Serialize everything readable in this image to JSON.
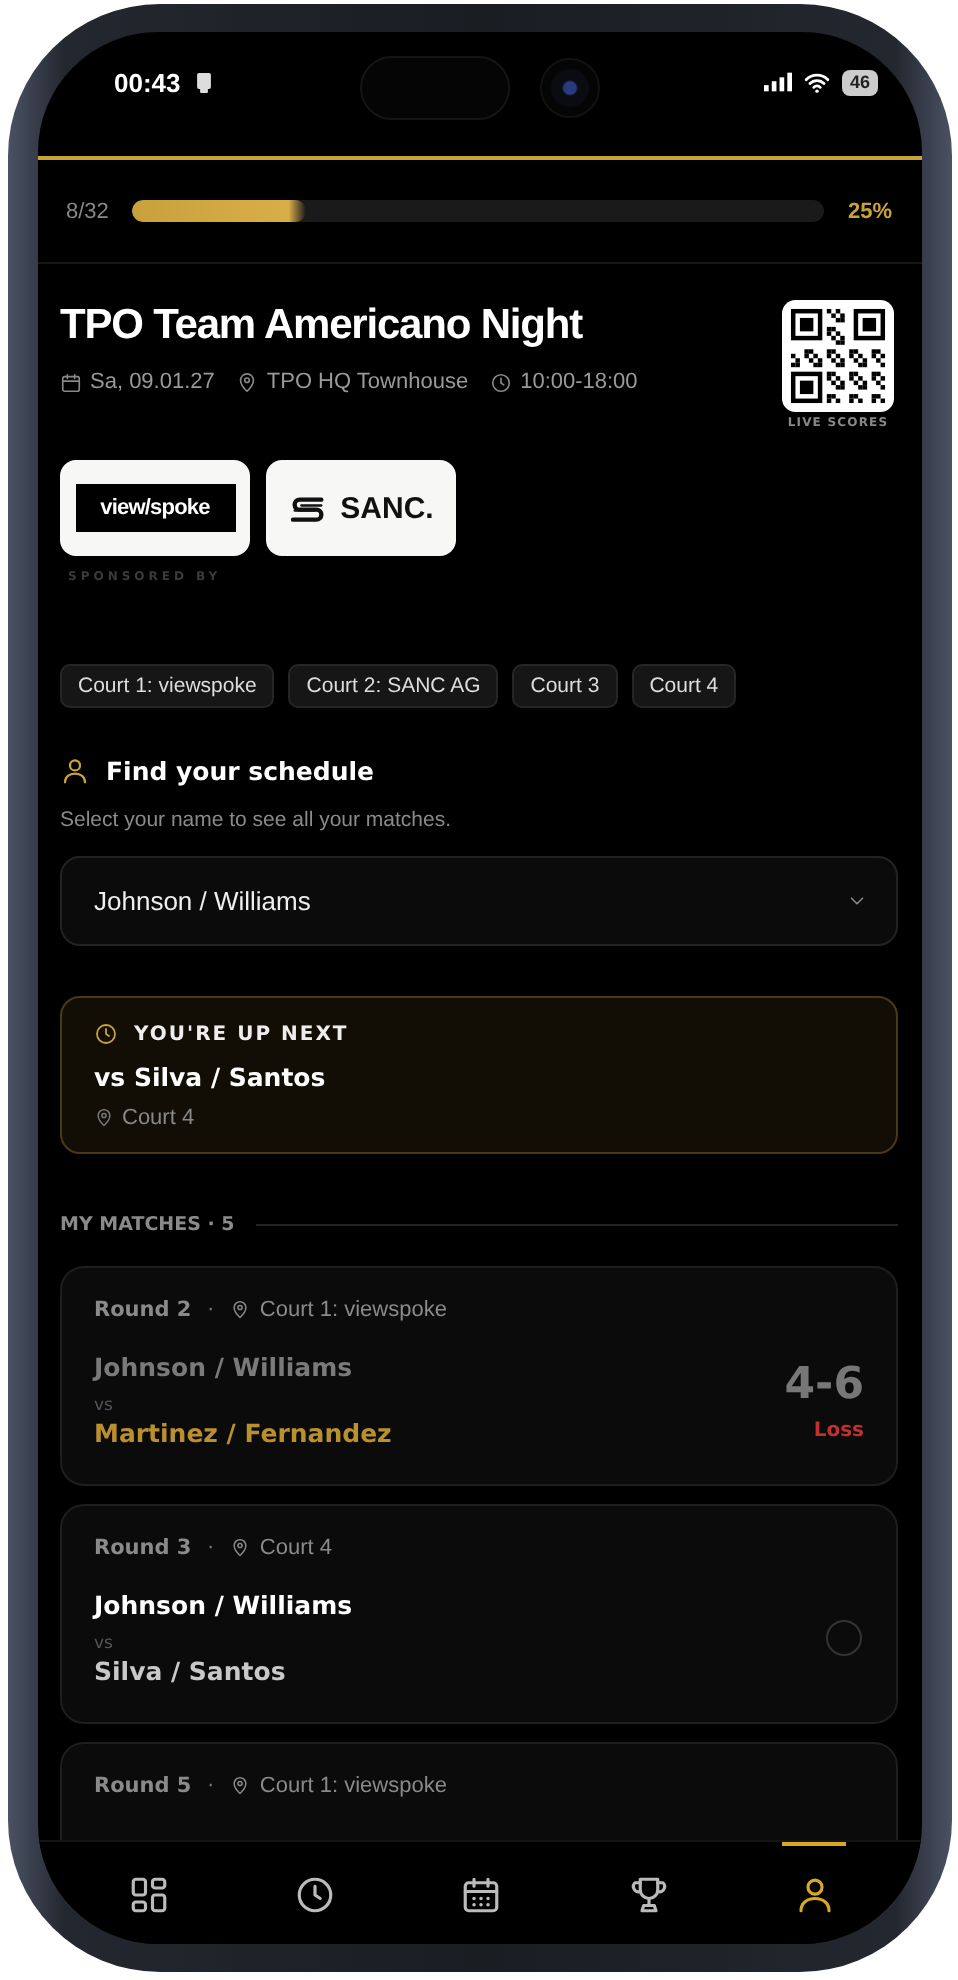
{
  "status_bar": {
    "time": "00:43",
    "battery": "46"
  },
  "progress": {
    "count": "8/32",
    "level": 0.25,
    "percent": "25%"
  },
  "event": {
    "title": "TPO Team Americano Night",
    "date": "Sa, 09.01.27",
    "venue": "TPO HQ Townhouse",
    "hours": "10:00-18:00",
    "qr_label": "LIVE SCORES"
  },
  "sponsors": {
    "items": [
      {
        "kind": "boxed",
        "name": "view/spoke"
      },
      {
        "kind": "mark",
        "name": "SANC."
      }
    ],
    "caption": "SPONSORED BY"
  },
  "courts": [
    "Court 1: viewspoke",
    "Court 2: SANC AG",
    "Court 3",
    "Court 4"
  ],
  "schedule": {
    "heading": "Find your schedule",
    "hint": "Select your name to see all your matches.",
    "value": "Johnson / Williams"
  },
  "up_next": {
    "label": "YOU'RE UP NEXT",
    "opponent": "vs Silva / Santos",
    "court": "Court 4"
  },
  "matches": {
    "heading": "MY MATCHES · 5",
    "items": [
      {
        "round": "Round 2",
        "sep": "·",
        "court": "Court 1: viewspoke",
        "kind": "completed",
        "team": "Johnson / Williams",
        "vs": "vs",
        "opponent": "Martinez / Fernandez",
        "score": "4-6",
        "result": "Loss"
      },
      {
        "round": "Round 3",
        "sep": "·",
        "court": "Court 4",
        "kind": "upcoming",
        "team": "Johnson / Williams",
        "vs": "vs",
        "opponent": "Silva / Santos"
      },
      {
        "round": "Round 5",
        "sep": "·",
        "court": "Court 1: viewspoke"
      }
    ]
  },
  "nav": [
    {
      "kind": "grid",
      "selected": false
    },
    {
      "kind": "clock",
      "selected": false
    },
    {
      "kind": "calendar",
      "selected": false
    },
    {
      "kind": "trophy",
      "selected": false
    },
    {
      "kind": "person",
      "selected": true
    }
  ]
}
